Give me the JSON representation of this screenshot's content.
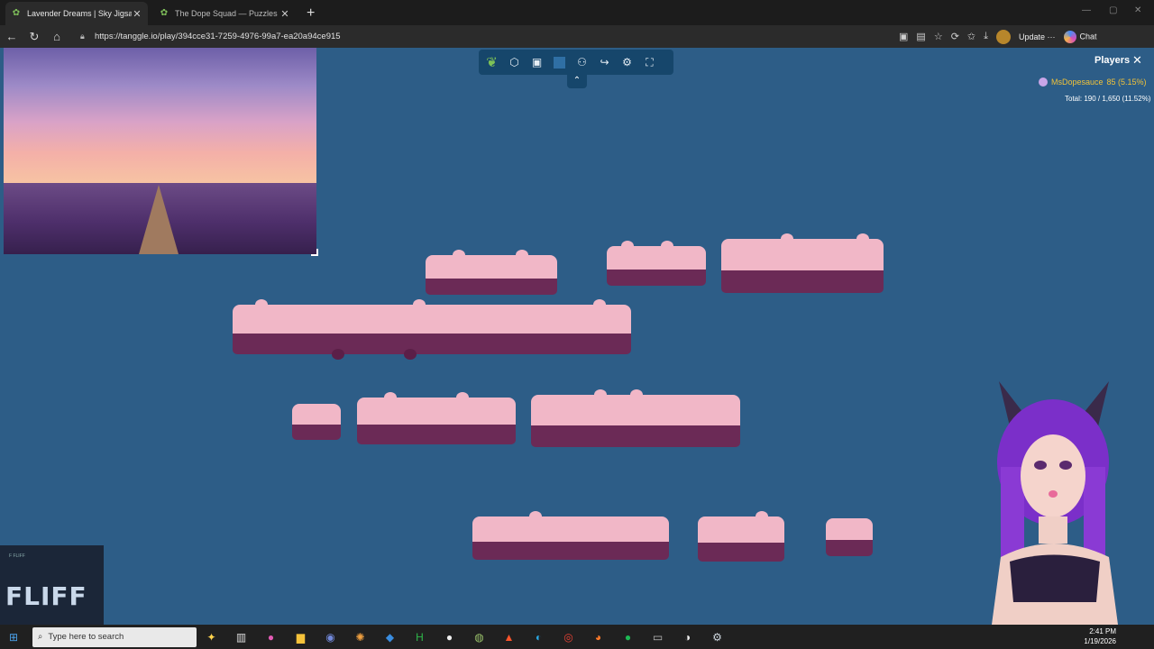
{
  "tabs": [
    {
      "title": "Lavender Dreams | Sky Jigsaw",
      "active": true
    },
    {
      "title": "The Dope Squad — Puzzles",
      "active": false
    }
  ],
  "address": {
    "url": "https://tanggle.io/play/394cce31-7259-4976-99a7-ea20a94ce915"
  },
  "nav": {
    "update_label": "Update",
    "chat_label": "Chat"
  },
  "players": {
    "title": "Players",
    "list": [
      {
        "name": "MsDopesauce",
        "score": "85 (5.15%)"
      }
    ],
    "total": "Total: 190 / 1,650 (11.52%)"
  },
  "overlay": {
    "logo_small": "F FLIFF",
    "logo_text": "FLIFF"
  },
  "taskbar": {
    "search_placeholder": "Type here to search",
    "time": "2:41 PM",
    "date": "1/19/2026"
  },
  "colors": {
    "page_bg": "#2d5d87",
    "toolbar_bg": "#16466b",
    "piece_pink": "#f1b7c7",
    "piece_purple": "#6b2a56"
  }
}
